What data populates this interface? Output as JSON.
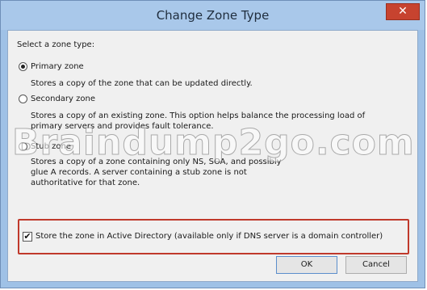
{
  "window": {
    "title": "Change Zone Type",
    "close_glyph": "✕"
  },
  "dialog": {
    "prompt": "Select a zone type:",
    "options": [
      {
        "label": "Primary zone",
        "description_lines": [
          "Stores a copy of the zone that can be updated directly."
        ],
        "selected": true
      },
      {
        "label": "Secondary zone",
        "description_lines": [
          "Stores a copy of an existing zone. This option helps balance the processing load of",
          "primary servers and provides fault tolerance."
        ],
        "selected": false
      },
      {
        "label": "Stub zone",
        "description_lines": [
          "Stores a copy of a zone containing only NS, SOA, and possibly",
          "glue A records. A server containing a stub zone is not",
          "authoritative for that zone."
        ],
        "selected": false
      }
    ],
    "store_in_ad": {
      "label": "Store the zone in Active Directory (available only if DNS server is a domain controller)",
      "checked": true,
      "check_glyph": "✔"
    },
    "ok_label": "OK",
    "cancel_label": "Cancel"
  },
  "watermark_text": "Braindump2go.com",
  "colors": {
    "titlebar": "#a9c8ea",
    "close_button": "#c7432f",
    "highlight": "#c0392b"
  },
  "icons": {
    "close": "close-icon",
    "radio": "radio-icon",
    "check": "checkmark-icon"
  }
}
